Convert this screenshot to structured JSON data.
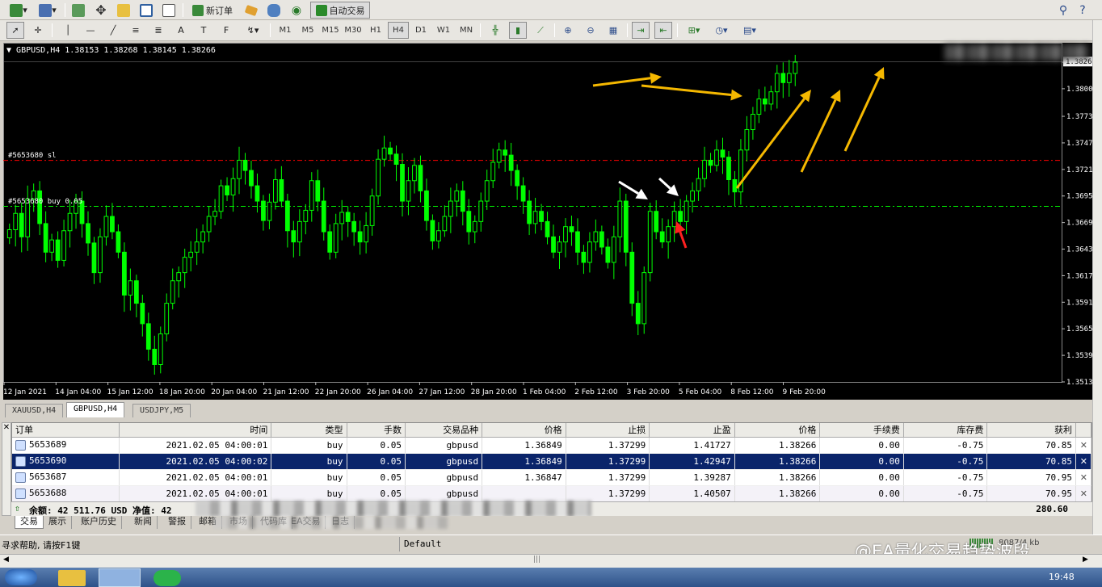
{
  "toolbar1": {
    "new_order_label": "新订单",
    "auto_trade_label": "自动交易"
  },
  "toolbar2": {
    "timeframes": [
      "M1",
      "M5",
      "M15",
      "M30",
      "H1",
      "H4",
      "D1",
      "W1",
      "MN"
    ],
    "active_timeframe": "H4"
  },
  "chart": {
    "header": "GBPUSD,H4  1.38153 1.38268 1.38145 1.38266",
    "price_tag": "1.3826",
    "sl_label": "#5653680 sl",
    "buy_label": "#5653680 buy 0.05"
  },
  "chart_data": {
    "type": "candlestick",
    "symbol": "GBPUSD",
    "timeframe": "H4",
    "last_bar": {
      "open": 1.38153,
      "high": 1.38268,
      "low": 1.38145,
      "close": 1.38266
    },
    "y_ticks": [
      "1.3826",
      "1.3800",
      "1.3773",
      "1.3747",
      "1.3721",
      "1.3695",
      "1.3669",
      "1.3643",
      "1.3617",
      "1.3591",
      "1.3565",
      "1.3539",
      "1.3513"
    ],
    "x_ticks": [
      "12 Jan 2021",
      "14 Jan 04:00",
      "15 Jan 12:00",
      "18 Jan 20:00",
      "20 Jan 04:00",
      "21 Jan 12:00",
      "22 Jan 20:00",
      "26 Jan 04:00",
      "27 Jan 12:00",
      "28 Jan 20:00",
      "1 Feb 04:00",
      "2 Feb 12:00",
      "3 Feb 20:00",
      "5 Feb 04:00",
      "8 Feb 12:00",
      "9 Feb 20:00"
    ],
    "ylim": [
      1.3513,
      1.3826
    ],
    "sl_level": 1.37299,
    "entry_level": 1.36849,
    "closes": [
      1.3662,
      1.3678,
      1.3655,
      1.3692,
      1.37,
      1.3668,
      1.364,
      1.3652,
      1.3632,
      1.3661,
      1.3678,
      1.369,
      1.3668,
      1.3649,
      1.362,
      1.3655,
      1.3675,
      1.366,
      1.364,
      1.3598,
      1.3612,
      1.359,
      1.357,
      1.3545,
      1.353,
      1.356,
      1.359,
      1.3612,
      1.362,
      1.3635,
      1.364,
      1.365,
      1.366,
      1.3675,
      1.368,
      1.3705,
      1.3696,
      1.3712,
      1.373,
      1.372,
      1.3705,
      1.369,
      1.3671,
      1.3689,
      1.3711,
      1.369,
      1.3661,
      1.365,
      1.367,
      1.3681,
      1.371,
      1.369,
      1.366,
      1.364,
      1.3668,
      1.3679,
      1.367,
      1.366,
      1.365,
      1.3666,
      1.3695,
      1.3731,
      1.3742,
      1.3736,
      1.3726,
      1.369,
      1.371,
      1.3725,
      1.37,
      1.3671,
      1.3651,
      1.3661,
      1.3675,
      1.369,
      1.37,
      1.368,
      1.366,
      1.367,
      1.369,
      1.371,
      1.3728,
      1.374,
      1.3735,
      1.372,
      1.3705,
      1.369,
      1.3668,
      1.368,
      1.367,
      1.3655,
      1.364,
      1.365,
      1.3665,
      1.366,
      1.364,
      1.363,
      1.365,
      1.366,
      1.3645,
      1.363,
      1.3655,
      1.369,
      1.364,
      1.359,
      1.357,
      1.362,
      1.368,
      1.366,
      1.365,
      1.3665,
      1.368,
      1.367,
      1.369,
      1.37,
      1.3712,
      1.373,
      1.3725,
      1.374,
      1.3733,
      1.3711,
      1.3699,
      1.374,
      1.376,
      1.3775,
      1.379,
      1.3785,
      1.3797,
      1.3815,
      1.3806,
      1.3815,
      1.3826
    ]
  },
  "chart_tabs": [
    "XAUUSD,H4",
    "GBPUSD,H4",
    "USDJPY,M5"
  ],
  "active_chart_tab": "GBPUSD,H4",
  "orders": {
    "columns": [
      "订单",
      "时间",
      "类型",
      "手数",
      "交易品种",
      "价格",
      "止损",
      "止盈",
      "价格",
      "手续费",
      "库存费",
      "获利"
    ],
    "rows": [
      [
        "5653689",
        "2021.02.05 04:00:01",
        "buy",
        "0.05",
        "gbpusd",
        "1.36849",
        "1.37299",
        "1.41727",
        "1.38266",
        "0.00",
        "-0.75",
        "70.85"
      ],
      [
        "5653690",
        "2021.02.05 04:00:02",
        "buy",
        "0.05",
        "gbpusd",
        "1.36849",
        "1.37299",
        "1.42947",
        "1.38266",
        "0.00",
        "-0.75",
        "70.85"
      ],
      [
        "5653687",
        "2021.02.05 04:00:01",
        "buy",
        "0.05",
        "gbpusd",
        "1.36847",
        "1.37299",
        "1.39287",
        "1.38266",
        "0.00",
        "-0.75",
        "70.95"
      ],
      [
        "5653688",
        "2021.02.05 04:00:01",
        "buy",
        "0.05",
        "gbpusd",
        "",
        "1.37299",
        "1.40507",
        "1.38266",
        "0.00",
        "-0.75",
        "70.95"
      ]
    ],
    "balance_text": "余额: 42 511.76 USD  净值: 42",
    "total_profit": "280.60"
  },
  "terminal_tabs": [
    "交易",
    "展示",
    "账户历史",
    "新闻",
    "警报",
    "邮箱",
    "市场",
    "代码库",
    "EA交易",
    "日志"
  ],
  "status": {
    "help": "寻求帮助, 请按F1键",
    "profile": "Default",
    "traffic": "8087/4 kb",
    "watermark": "@EA量化交易趋势波段"
  },
  "taskbar": {
    "clock": "19:48"
  },
  "colors": {
    "bull": "#00ff00",
    "chart_bg": "#000000",
    "sl_line": "#ff0000",
    "entry_line": "#00ff00",
    "arrow_gold": "#f5b800",
    "selected_row": "#0a246a"
  }
}
